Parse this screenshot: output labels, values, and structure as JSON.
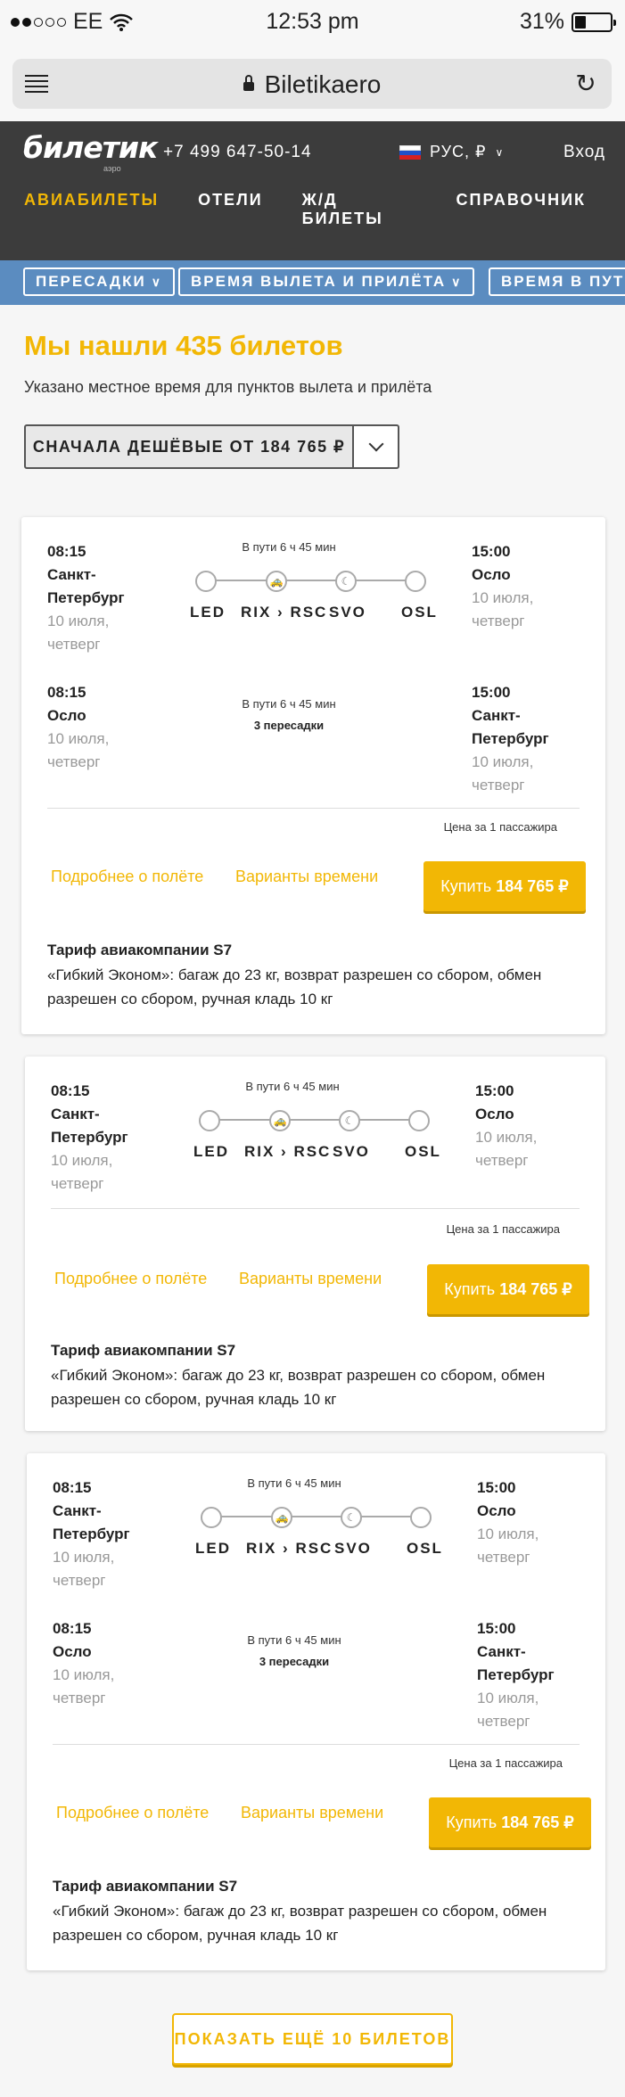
{
  "status_bar": {
    "carrier": "EE",
    "time": "12:53 pm",
    "battery": "31%",
    "battery_level": 0.31
  },
  "browser": {
    "url": "Biletikaero"
  },
  "header": {
    "logo": "билетик",
    "logo_sub": "аэро",
    "phone": "+7 499 647-50-14",
    "lang": "РУС, ₽",
    "login": "Вход",
    "nav": [
      "АВИАБИЛЕТЫ",
      "ОТЕЛИ",
      "Ж/Д БИЛЕТЫ",
      "СПРАВОЧНИК"
    ]
  },
  "filters": [
    "ПЕРЕСАДКИ",
    "ВРЕМЯ ВЫЛЕТА И ПРИЛЁТА",
    "ВРЕМЯ В ПУТИ"
  ],
  "results": {
    "title": "Мы нашли 435 билетов",
    "subtitle": "Указано местное время для пунктов вылета и прилёта",
    "sort_label": "СНАЧАЛА ДЕШЁВЫЕ ОТ 184 765 ₽"
  },
  "ticket": {
    "out": {
      "dep_time": "08:15",
      "dep_city": "Санкт-Петербург",
      "dep_date": "10 июля, четверг",
      "duration": "В пути 6 ч 45 мин",
      "arr_time": "15:00",
      "arr_city": "Осло",
      "arr_date": "10 июля, четверг",
      "codes": [
        "LED",
        "RIX › RSC",
        "SVO",
        "OSL"
      ]
    },
    "back": {
      "dep_time": "08:15",
      "dep_city": "Осло",
      "dep_date": "10 июля, четверг",
      "duration": "В пути 6 ч 45 мин",
      "stops": "3 пересадки",
      "arr_time": "15:00",
      "arr_city": "Санкт-Петербург",
      "arr_date": "10 июля, четверг"
    },
    "price_note": "Цена за 1 пассажира",
    "details_link": "Подробнее о полёте",
    "variants_link": "Варианты времени",
    "buy_label": "Купить",
    "price": "184 765 ₽",
    "tariff_title": "Тариф авиакомпании S7",
    "tariff_text": "«Гибкий Эконом»: багаж до 23 кг, возврат разрешен со сбором, обмен разрешен со сбором, ручная кладь 10 кг"
  },
  "show_more": "ПОКАЗАТЬ ЕЩЁ 10 БИЛЕТОВ"
}
